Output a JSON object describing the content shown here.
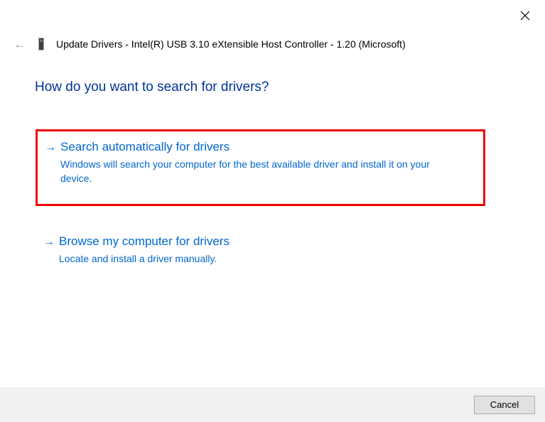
{
  "header": {
    "title": "Update Drivers - Intel(R) USB 3.10 eXtensible Host Controller - 1.20 (Microsoft)"
  },
  "main": {
    "heading": "How do you want to search for drivers?"
  },
  "options": [
    {
      "title": "Search automatically for drivers",
      "description": "Windows will search your computer for the best available driver and install it on your device."
    },
    {
      "title": "Browse my computer for drivers",
      "description": "Locate and install a driver manually."
    }
  ],
  "footer": {
    "cancel_label": "Cancel"
  }
}
